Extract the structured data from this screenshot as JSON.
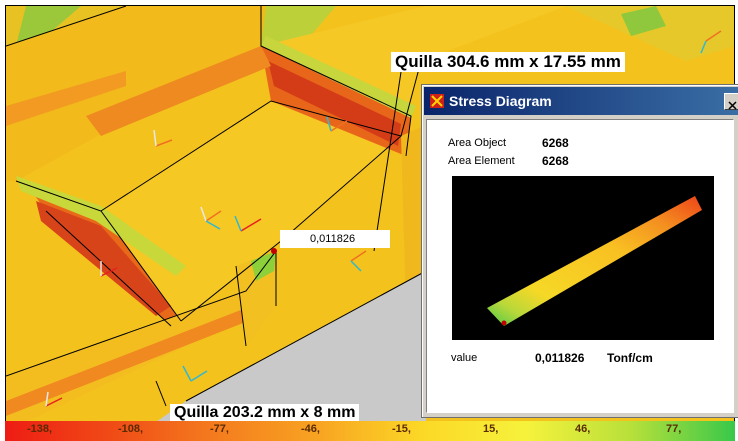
{
  "callouts": {
    "top": "Quilla 304.6 mm x 17.55 mm",
    "bottom": "Quilla 203.2 mm x 8 mm",
    "point_value": "0,011826"
  },
  "stress_window": {
    "title": "Stress Diagram",
    "area_object_label": "Area Object",
    "area_object_value": "6268",
    "area_element_label": "Area Element",
    "area_element_value": "6268",
    "value_label": "value",
    "value": "0,011826",
    "unit": "Tonf/cm"
  },
  "legend": {
    "labels": [
      "-138,",
      "-108,",
      "-77,",
      "-46,",
      "-15,",
      "15,",
      "46,",
      "77,"
    ],
    "colors": [
      "#ee1c14",
      "#f04a16",
      "#f47b1e",
      "#f8a422",
      "#fcd826",
      "#f6f23c",
      "#b8e03a",
      "#38c84a"
    ]
  },
  "colors": {
    "model_base": "#f3c21d",
    "titlebar_start": "#0a246a",
    "titlebar_end": "#3a6ea5"
  },
  "icons": [
    "app-icon",
    "close-icon"
  ]
}
